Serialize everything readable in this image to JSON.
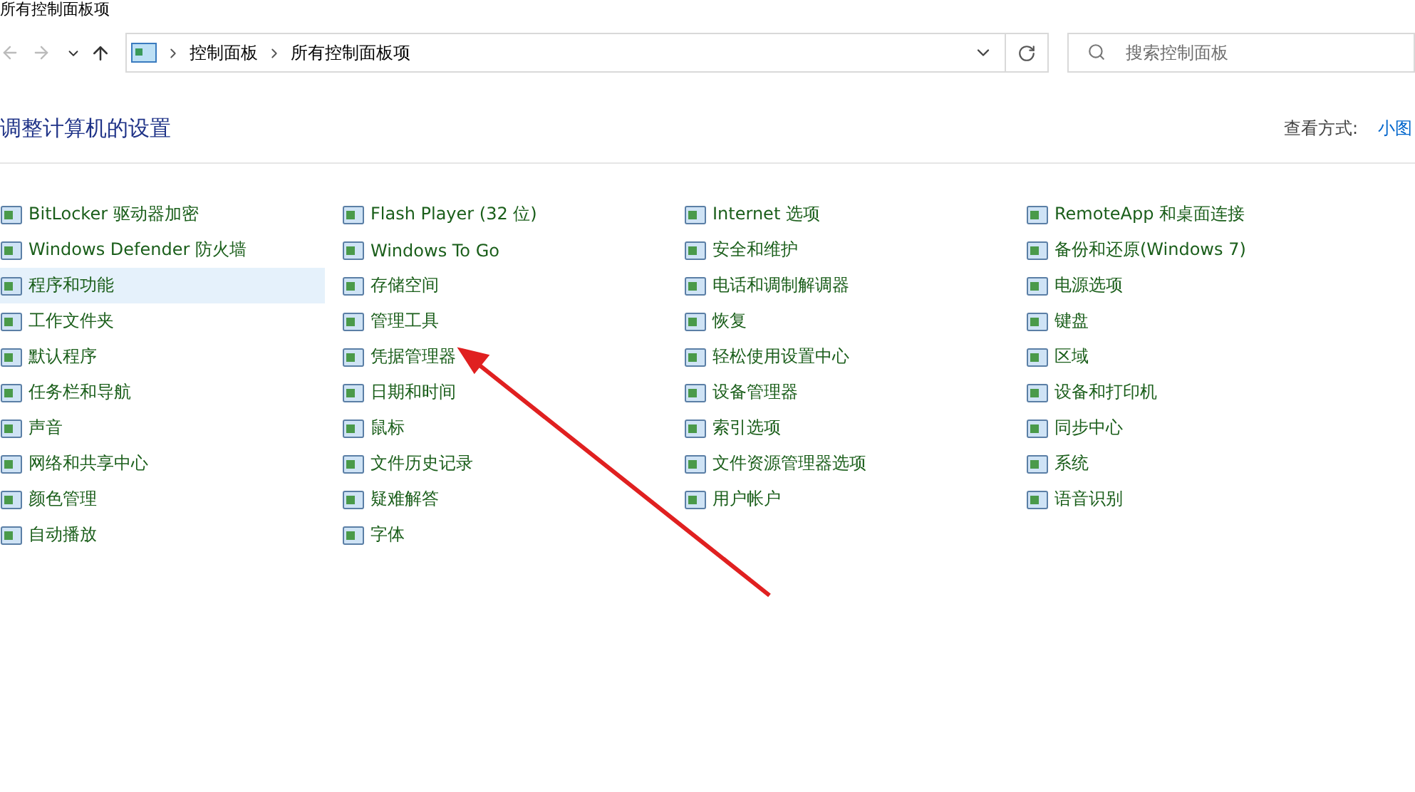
{
  "window": {
    "title": "所有控制面板项"
  },
  "address_bar": {
    "breadcrumbs": [
      "控制面板",
      "所有控制面板项"
    ]
  },
  "search": {
    "placeholder": "搜索控制面板"
  },
  "header": {
    "title": "调整计算机的设置",
    "view_label": "查看方式:",
    "view_value": "小图"
  },
  "columns": [
    [
      {
        "label": "BitLocker 驱动器加密",
        "selected": false
      },
      {
        "label": "Windows Defender 防火墙",
        "selected": false
      },
      {
        "label": "程序和功能",
        "selected": true
      },
      {
        "label": "工作文件夹",
        "selected": false
      },
      {
        "label": "默认程序",
        "selected": false
      },
      {
        "label": "任务栏和导航",
        "selected": false
      },
      {
        "label": "声音",
        "selected": false
      },
      {
        "label": "网络和共享中心",
        "selected": false
      },
      {
        "label": "颜色管理",
        "selected": false
      },
      {
        "label": "自动播放",
        "selected": false
      }
    ],
    [
      {
        "label": "Flash Player (32 位)",
        "selected": false
      },
      {
        "label": "Windows To Go",
        "selected": false
      },
      {
        "label": "存储空间",
        "selected": false
      },
      {
        "label": "管理工具",
        "selected": false
      },
      {
        "label": "凭据管理器",
        "selected": false
      },
      {
        "label": "日期和时间",
        "selected": false
      },
      {
        "label": "鼠标",
        "selected": false
      },
      {
        "label": "文件历史记录",
        "selected": false
      },
      {
        "label": "疑难解答",
        "selected": false
      },
      {
        "label": "字体",
        "selected": false
      }
    ],
    [
      {
        "label": "Internet 选项",
        "selected": false
      },
      {
        "label": "安全和维护",
        "selected": false
      },
      {
        "label": "电话和调制解调器",
        "selected": false
      },
      {
        "label": "恢复",
        "selected": false
      },
      {
        "label": "轻松使用设置中心",
        "selected": false
      },
      {
        "label": "设备管理器",
        "selected": false
      },
      {
        "label": "索引选项",
        "selected": false
      },
      {
        "label": "文件资源管理器选项",
        "selected": false
      },
      {
        "label": "用户帐户",
        "selected": false
      }
    ],
    [
      {
        "label": "RemoteApp 和桌面连接",
        "selected": false
      },
      {
        "label": "备份和还原(Windows 7)",
        "selected": false
      },
      {
        "label": "电源选项",
        "selected": false
      },
      {
        "label": "键盘",
        "selected": false
      },
      {
        "label": "区域",
        "selected": false
      },
      {
        "label": "设备和打印机",
        "selected": false
      },
      {
        "label": "同步中心",
        "selected": false
      },
      {
        "label": "系统",
        "selected": false
      },
      {
        "label": "语音识别",
        "selected": false
      }
    ]
  ]
}
